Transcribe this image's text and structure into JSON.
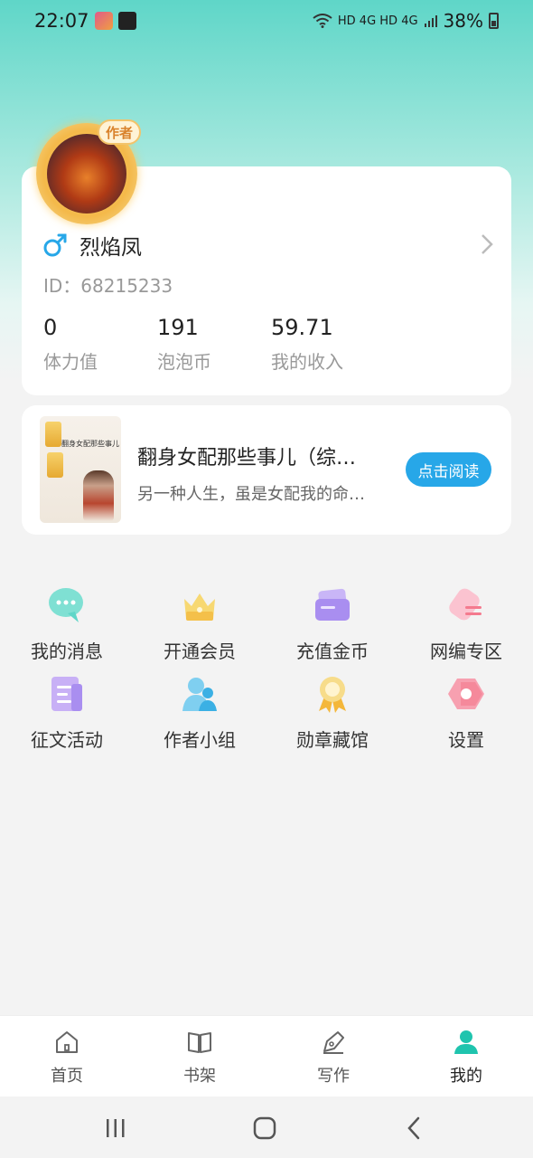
{
  "status_bar": {
    "time": "22:07",
    "network": "HD 4G HD 4G",
    "battery": "38%"
  },
  "profile": {
    "badge": "作者",
    "username": "烈焰凤",
    "id_text": "ID：68215233",
    "stats": [
      {
        "value": "0",
        "label": "体力值"
      },
      {
        "value": "191",
        "label": "泡泡币"
      },
      {
        "value": "59.71",
        "label": "我的收入"
      }
    ]
  },
  "book": {
    "cover_title": "翻身女配那些事儿",
    "title": "翻身女配那些事儿（综…",
    "desc": "另一种人生，虽是女配我的命…",
    "read_label": "点击阅读"
  },
  "grid": [
    {
      "label": "我的消息",
      "icon": "message-icon",
      "color": "#5fd6c8"
    },
    {
      "label": "开通会员",
      "icon": "crown-icon",
      "color": "#f4cc5a"
    },
    {
      "label": "充值金币",
      "icon": "wallet-icon",
      "color": "#a98ef0"
    },
    {
      "label": "网编专区",
      "icon": "editor-icon",
      "color": "#f59ab2"
    },
    {
      "label": "征文活动",
      "icon": "document-icon",
      "color": "#b79af2"
    },
    {
      "label": "作者小组",
      "icon": "group-icon",
      "color": "#5cc1ea"
    },
    {
      "label": "勋章藏馆",
      "icon": "medal-icon",
      "color": "#f4cc5a"
    },
    {
      "label": "设置",
      "icon": "settings-icon",
      "color": "#f47a8e"
    }
  ],
  "bottom_nav": [
    {
      "label": "首页",
      "icon": "home-icon"
    },
    {
      "label": "书架",
      "icon": "book-icon"
    },
    {
      "label": "写作",
      "icon": "pen-icon"
    },
    {
      "label": "我的",
      "icon": "user-icon",
      "active": true
    }
  ],
  "colors": {
    "accent": "#1fc4ae",
    "button": "#27a7e8"
  }
}
